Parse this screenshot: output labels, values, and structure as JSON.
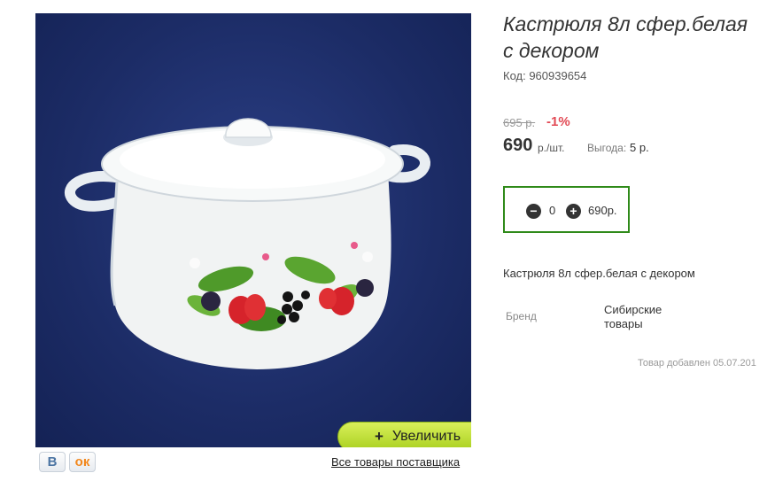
{
  "product": {
    "title": "Кастрюля 8л сфер.белая с декором",
    "title_line1": "Кастрюля 8л сфер.белая",
    "title_line2": "с декором",
    "code": "Код: 960939654",
    "old_price": "695 р.",
    "discount": "-1%",
    "price": "690",
    "price_unit": "р./шт.",
    "benefit_label": "Выгода:",
    "benefit_value": "5 р.",
    "description": "Кастрюля 8л сфер.белая с декором",
    "brand_label": "Бренд",
    "brand_value": "Сибирские товары",
    "added": "Товар добавлен 05.07.201"
  },
  "cart": {
    "minus": "−",
    "plus": "+",
    "quantity": "0",
    "total": "690р."
  },
  "gallery": {
    "zoom_plus": "+",
    "zoom_label": "Увеличить",
    "supplier_link": "Все товары поставщика"
  },
  "social": {
    "vk": "В",
    "ok": "ок"
  },
  "colors": {
    "photo_bg": "#1c2c66",
    "zoom_button": "#c2e23a",
    "qty_border": "#2f8a19",
    "discount": "#e24a55"
  }
}
